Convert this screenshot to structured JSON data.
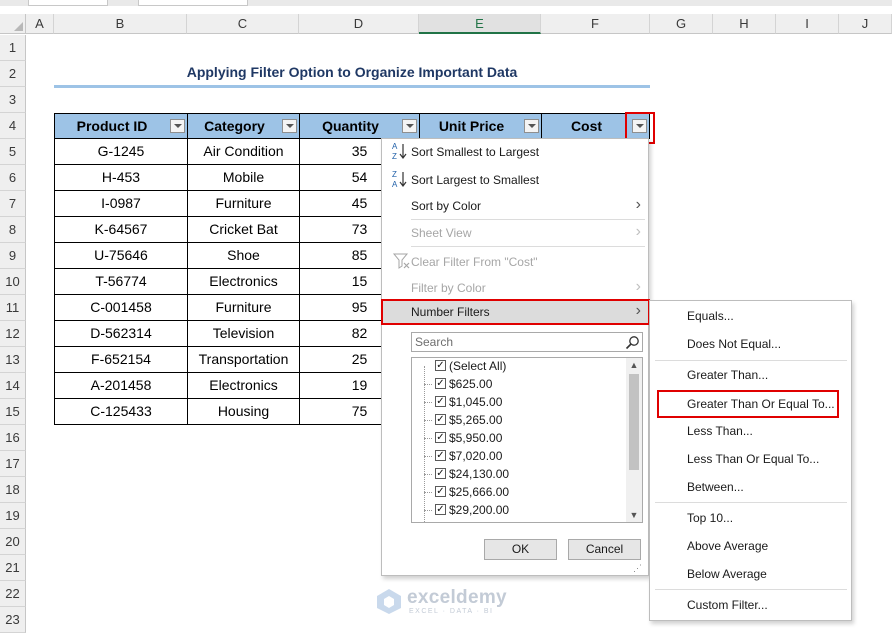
{
  "columns": [
    "A",
    "B",
    "C",
    "D",
    "E",
    "F",
    "G",
    "H",
    "I",
    "J"
  ],
  "rows": [
    "1",
    "2",
    "3",
    "4",
    "5",
    "6",
    "7",
    "8",
    "9",
    "10",
    "11",
    "12",
    "13",
    "14",
    "15",
    "16",
    "17",
    "18",
    "19",
    "20",
    "21",
    "22",
    "23"
  ],
  "title": "Applying Filter Option to Organize Important Data",
  "table": {
    "headers": [
      "Product ID",
      "Category",
      "Quantity",
      "Unit Price",
      "Cost"
    ],
    "rows": [
      [
        "G-1245",
        "Air Condition",
        "35"
      ],
      [
        "H-453",
        "Mobile",
        "54"
      ],
      [
        "I-0987",
        "Furniture",
        "45"
      ],
      [
        "K-64567",
        "Cricket Bat",
        "73"
      ],
      [
        "U-75646",
        "Shoe",
        "85"
      ],
      [
        "T-56774",
        "Electronics",
        "15"
      ],
      [
        "C-001458",
        "Furniture",
        "95"
      ],
      [
        "D-562314",
        "Television",
        "82"
      ],
      [
        "F-652154",
        "Transportation",
        "25"
      ],
      [
        "A-201458",
        "Electronics",
        "19"
      ],
      [
        "C-125433",
        "Housing",
        "75"
      ]
    ]
  },
  "filter_menu": {
    "sort_asc": "Sort Smallest to Largest",
    "sort_desc": "Sort Largest to Smallest",
    "sort_by_color": "Sort by Color",
    "sheet_view": "Sheet View",
    "clear_filter": "Clear Filter From \"Cost\"",
    "filter_by_color": "Filter by Color",
    "number_filters": "Number Filters",
    "search_placeholder": "Search",
    "select_all": "(Select All)",
    "values": [
      "$625.00",
      "$1,045.00",
      "$5,265.00",
      "$5,950.00",
      "$7,020.00",
      "$24,130.00",
      "$25,666.00",
      "$29,200.00"
    ],
    "ok": "OK",
    "cancel": "Cancel"
  },
  "number_filters_submenu": {
    "equals": "Equals...",
    "not_equal": "Does Not Equal...",
    "greater": "Greater Than...",
    "greater_equal": "Greater Than Or Equal To...",
    "less": "Less Than...",
    "less_equal": "Less Than Or Equal To...",
    "between": "Between...",
    "top10": "Top 10...",
    "above_avg": "Above Average",
    "below_avg": "Below Average",
    "custom": "Custom Filter..."
  },
  "watermark": {
    "name": "exceldemy",
    "tagline": "EXCEL · DATA · BI"
  },
  "colors": {
    "header_fill": "#9dc3e6",
    "title": "#1f3864",
    "highlight": "#e00000",
    "selected_col": "#217346"
  },
  "icons": [
    "sort-ascending-icon",
    "sort-descending-icon",
    "funnel-clear-icon",
    "chevron-right-icon",
    "magnifier-icon",
    "checkbox-icon",
    "dropdown-arrow-icon"
  ]
}
